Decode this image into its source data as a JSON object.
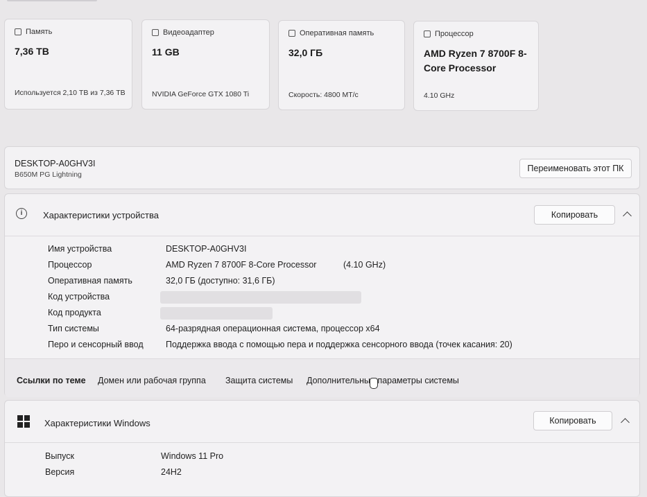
{
  "cards": [
    {
      "title": "Память",
      "value": "7,36 ТВ",
      "sub": "Используется 2,10 ТВ из 7,36 ТВ"
    },
    {
      "title": "Видеоадаптер",
      "value": "11 GB",
      "sub": "NVIDIA GeForce GTX 1080 Ti"
    },
    {
      "title": "Оперативная память",
      "value": "32,0 ГБ",
      "sub": "Скорость: 4800 МТ/с"
    },
    {
      "title": "Процессор",
      "value": "AMD Ryzen 7 8700F 8-Core Processor",
      "sub": "4.10 GHz"
    }
  ],
  "pc": {
    "name": "DESKTOP-A0GHV3I",
    "model": "B650M PG Lightning",
    "rename_label": "Переименовать этот ПК"
  },
  "device": {
    "title": "Характеристики устройства",
    "copy_label": "Копировать",
    "rows": [
      {
        "label": "Имя устройства",
        "value": "DESKTOP-A0GHV3I"
      },
      {
        "label": "Процессор",
        "value": "AMD Ryzen 7 8700F 8-Core Processor",
        "extra": "(4.10 GHz)"
      },
      {
        "label": "Оперативная память",
        "value": "32,0 ГБ (доступно: 31,6 ГБ)"
      },
      {
        "label": "Код устройства",
        "value": ""
      },
      {
        "label": "Код продукта",
        "value": ""
      },
      {
        "label": "Тип системы",
        "value": "64-разрядная операционная система, процессор x64"
      },
      {
        "label": "Перо и сенсорный ввод",
        "value": "Поддержка ввода с помощью пера и поддержка сенсорного ввода (точек касания: 20)"
      }
    ]
  },
  "links": {
    "heading": "Ссылки по теме",
    "items": [
      "Домен или рабочая группа",
      "Защита системы",
      "Дополнительные параметры системы"
    ]
  },
  "windows": {
    "title": "Характеристики Windows",
    "copy_label": "Копировать",
    "rows": [
      {
        "label": "Выпуск",
        "value": "Windows 11 Pro"
      },
      {
        "label": "Версия",
        "value": "24H2"
      }
    ]
  }
}
